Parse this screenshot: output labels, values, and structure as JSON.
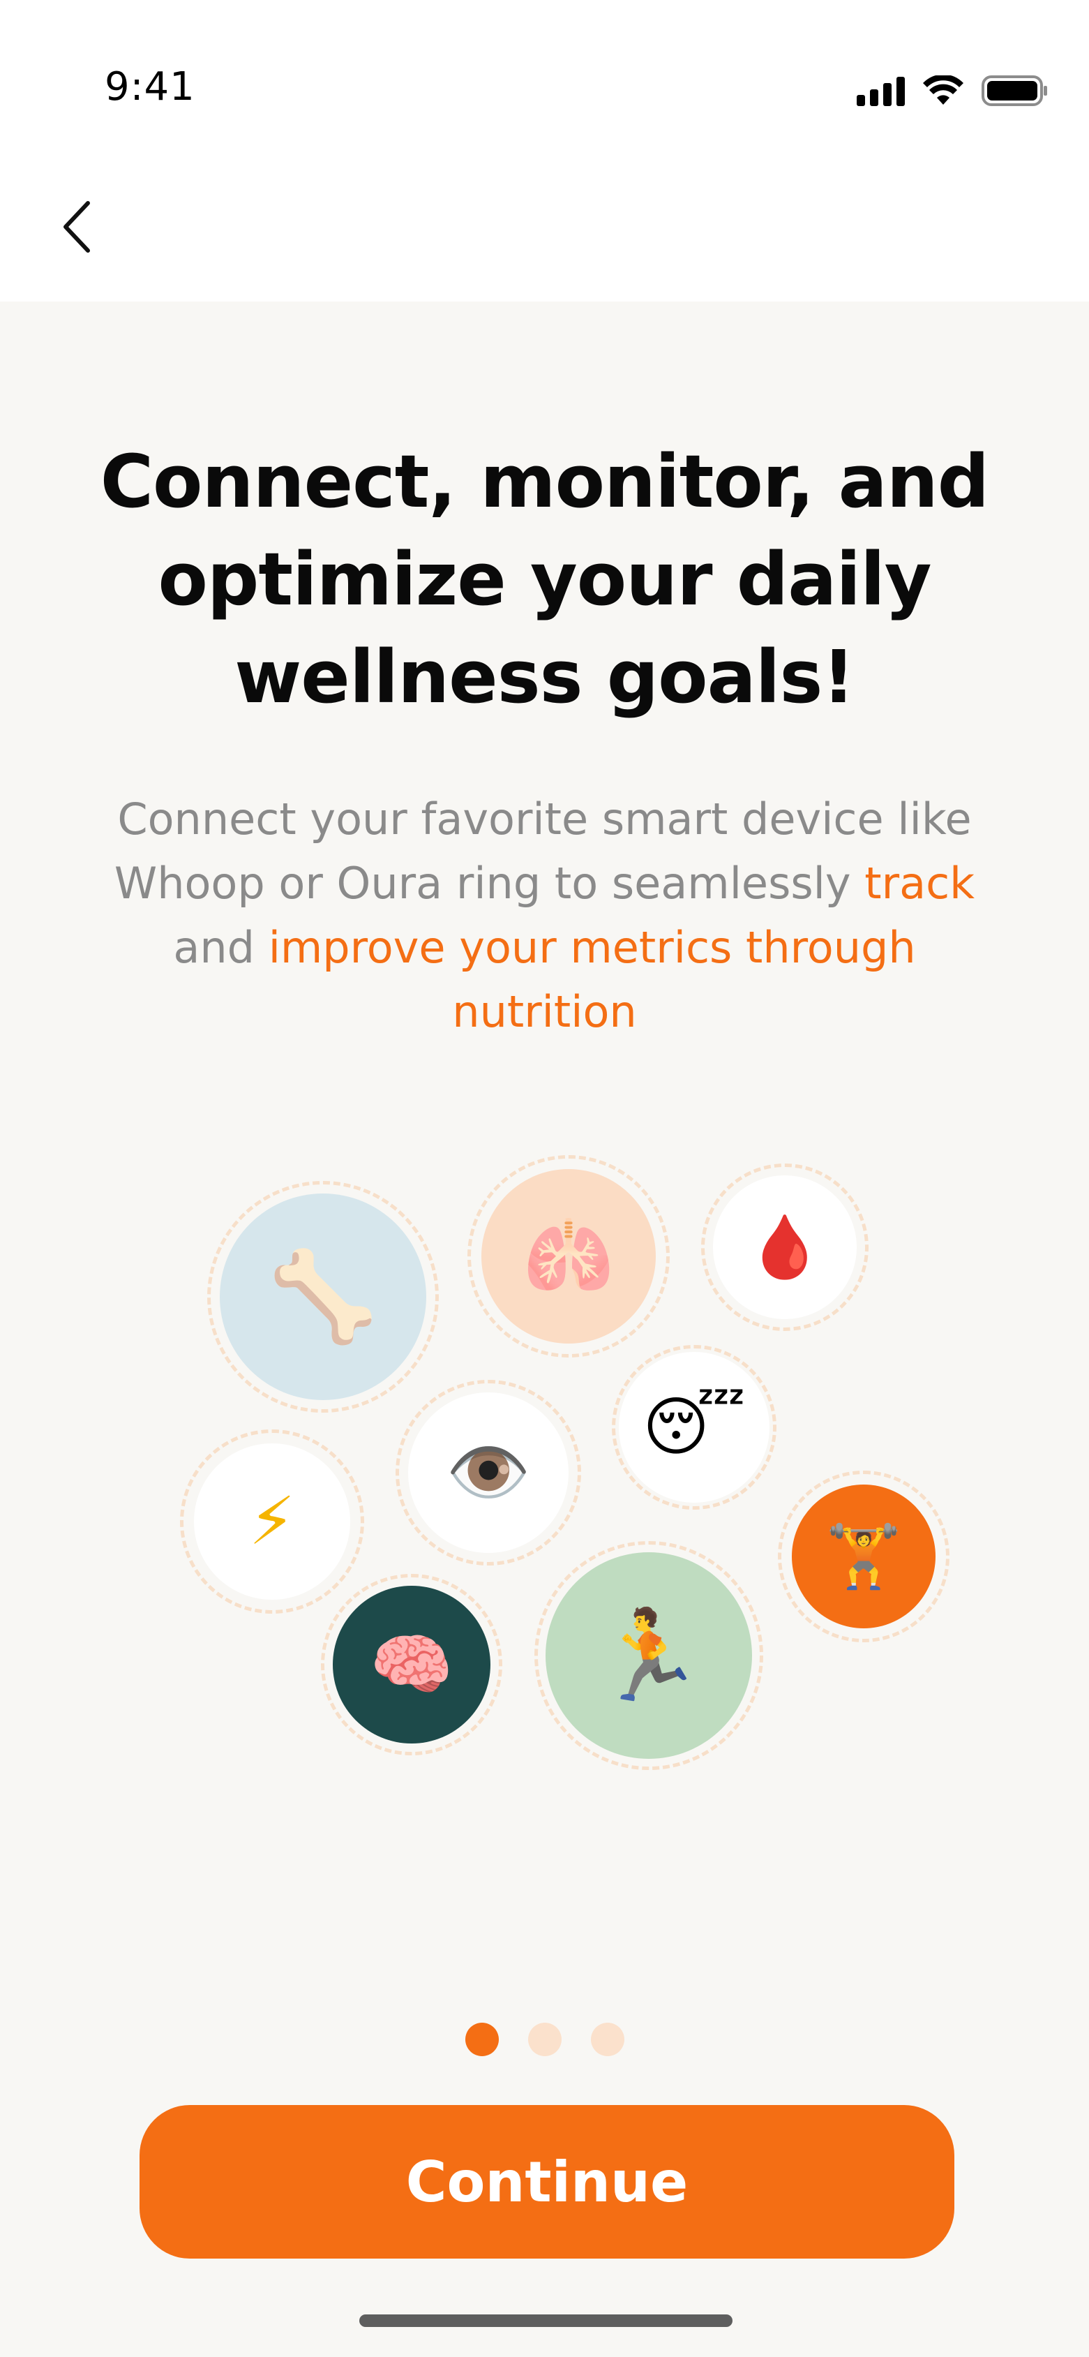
{
  "status_bar": {
    "time": "9:41"
  },
  "onboarding": {
    "headline": [
      "Connect, monitor, and",
      "optimize your daily",
      "wellness goals!"
    ],
    "subtitle": {
      "part1": "Connect your favorite smart device like Whoop or Oura ring to seamlessly ",
      "highlight1": "track",
      "part2": " and ",
      "highlight2": "improve your metrics through nutrition"
    },
    "metrics": [
      {
        "name": "bone",
        "glyph": "🦴",
        "bg": "#d6e6ec"
      },
      {
        "name": "lungs",
        "glyph": "🫁",
        "bg": "#fbdcc4"
      },
      {
        "name": "blood-drop",
        "glyph": "🩸",
        "bg": "#ffffff"
      },
      {
        "name": "energy",
        "glyph": "⚡",
        "bg": "#ffffff"
      },
      {
        "name": "eye",
        "glyph": "👁️",
        "bg": "#ffffff"
      },
      {
        "name": "sleep",
        "glyph": "😴",
        "bg": "#ffffff"
      },
      {
        "name": "dumbbell",
        "glyph": "🏋",
        "bg": "#f46e14"
      },
      {
        "name": "brain",
        "glyph": "🧠",
        "bg": "#1d4a4a"
      },
      {
        "name": "running",
        "glyph": "🏃",
        "bg": "#bfdcc0"
      }
    ],
    "pagination": {
      "current": 1,
      "total": 3
    },
    "continue_label": "Continue"
  },
  "colors": {
    "accent": "#f46e14",
    "panel_bg": "#f8f7f4",
    "muted_text": "#8a8a8a"
  }
}
